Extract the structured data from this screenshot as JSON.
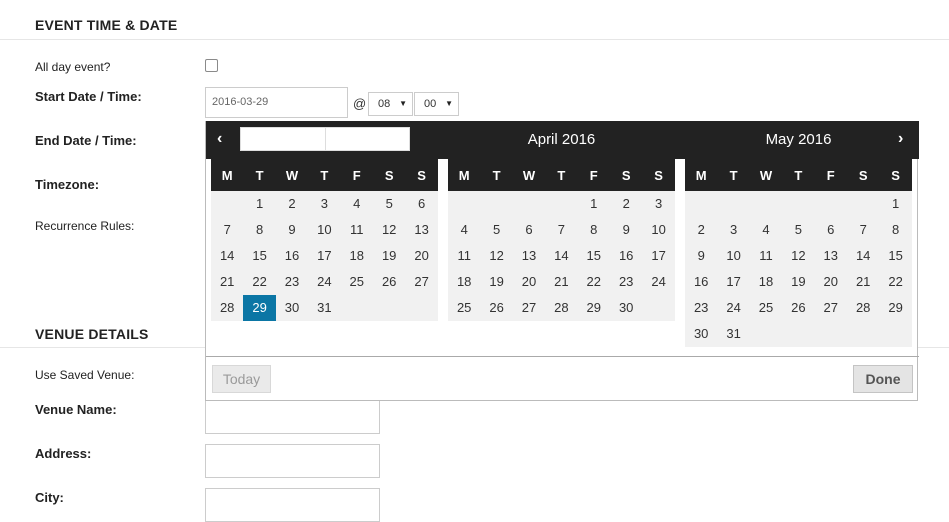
{
  "event_section": {
    "title": "EVENT TIME & DATE",
    "all_day_label": "All day event?",
    "start_label": "Start Date / Time:",
    "end_label": "End Date / Time:",
    "timezone_label": "Timezone:",
    "recurrence_label": "Recurrence Rules:",
    "start_date_value": "2016-03-29",
    "at_sign": "@",
    "hour_value": "08",
    "minute_value": "00",
    "caret": "▼"
  },
  "venue_section": {
    "title": "VENUE DETAILS",
    "use_saved_label": "Use Saved Venue:",
    "venue_name_label": "Venue Name:",
    "address_label": "Address:",
    "city_label": "City:"
  },
  "datepicker": {
    "prev_label": "‹",
    "next_label": "›",
    "weekday_headers": [
      "M",
      "T",
      "W",
      "T",
      "F",
      "S",
      "S"
    ],
    "months": [
      {
        "title": "",
        "offset": 0,
        "weeks": [
          [
            "",
            "1",
            "2",
            "3",
            "4",
            "5",
            "6"
          ],
          [
            "7",
            "8",
            "9",
            "10",
            "11",
            "12",
            "13"
          ],
          [
            "14",
            "15",
            "16",
            "17",
            "18",
            "19",
            "20"
          ],
          [
            "21",
            "22",
            "23",
            "24",
            "25",
            "26",
            "27"
          ],
          [
            "28",
            "29",
            "30",
            "31",
            "",
            "",
            ""
          ]
        ],
        "selected": "29"
      },
      {
        "title": "April 2016",
        "weeks": [
          [
            "",
            "",
            "",
            "",
            "1",
            "2",
            "3"
          ],
          [
            "4",
            "5",
            "6",
            "7",
            "8",
            "9",
            "10"
          ],
          [
            "11",
            "12",
            "13",
            "14",
            "15",
            "16",
            "17"
          ],
          [
            "18",
            "19",
            "20",
            "21",
            "22",
            "23",
            "24"
          ],
          [
            "25",
            "26",
            "27",
            "28",
            "29",
            "30",
            ""
          ]
        ],
        "selected": ""
      },
      {
        "title": "May 2016",
        "weeks": [
          [
            "",
            "",
            "",
            "",
            "",
            "",
            "1"
          ],
          [
            "2",
            "3",
            "4",
            "5",
            "6",
            "7",
            "8"
          ],
          [
            "9",
            "10",
            "11",
            "12",
            "13",
            "14",
            "15"
          ],
          [
            "16",
            "17",
            "18",
            "19",
            "20",
            "21",
            "22"
          ],
          [
            "23",
            "24",
            "25",
            "26",
            "27",
            "28",
            "29"
          ],
          [
            "30",
            "31",
            "",
            "",
            "",
            "",
            ""
          ]
        ],
        "selected": ""
      }
    ],
    "today_label": "Today",
    "done_label": "Done",
    "colors": {
      "header_bg": "#222222",
      "grid_bg": "#f1f1f1",
      "selected_bg": "#0b76a5"
    }
  }
}
